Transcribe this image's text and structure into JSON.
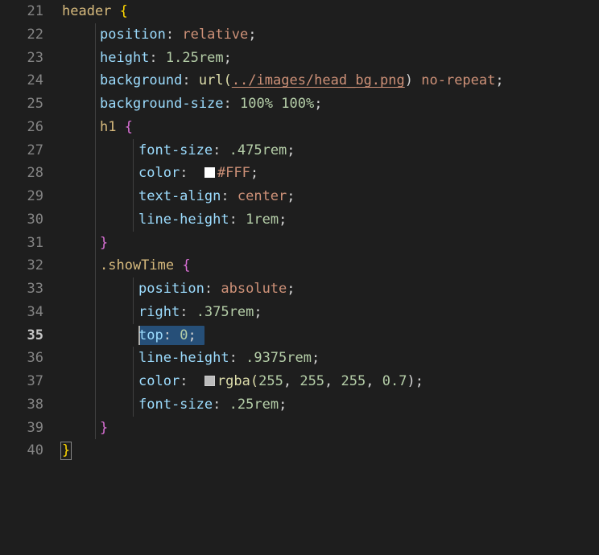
{
  "editor": {
    "language": "css",
    "theme": "Dark+ (default dark)",
    "background_color": "#1e1e1e",
    "selection_color": "#264f78",
    "cursor_color": "#aeafad",
    "first_visible_line": 21,
    "last_visible_line": 40,
    "active_line": 35,
    "selected_text": "top: 0;"
  },
  "gutter": {
    "numbers": [
      "21",
      "22",
      "23",
      "24",
      "25",
      "26",
      "27",
      "28",
      "29",
      "30",
      "31",
      "32",
      "33",
      "34",
      "35",
      "36",
      "37",
      "38",
      "39",
      "40"
    ]
  },
  "swatches": {
    "white": "#FFFFFF",
    "white_70": "rgba(255,255,255,0.7)"
  },
  "code": {
    "l21": {
      "selector": "header",
      "brace": "{"
    },
    "l22": {
      "prop": "position",
      "colon": ":",
      "value": "relative",
      "semi": ";"
    },
    "l23": {
      "prop": "height",
      "colon": ":",
      "num": "1.25",
      "unit": "rem",
      "semi": ";"
    },
    "l24": {
      "prop": "background",
      "colon": ":",
      "fn": "url(",
      "str": "../images/head_bg.png",
      "close": ")",
      "value": "no-repeat",
      "semi": ";"
    },
    "l25": {
      "prop": "background-size",
      "colon": ":",
      "v1": "100%",
      "v2": "100%",
      "semi": ";"
    },
    "l26": {
      "selector": "h1",
      "brace": "{"
    },
    "l27": {
      "prop": "font-size",
      "colon": ":",
      "num": ".475",
      "unit": "rem",
      "semi": ";"
    },
    "l28": {
      "prop": "color",
      "colon": ":",
      "hex": "#FFF",
      "semi": ";"
    },
    "l29": {
      "prop": "text-align",
      "colon": ":",
      "value": "center",
      "semi": ";"
    },
    "l30": {
      "prop": "line-height",
      "colon": ":",
      "num": "1",
      "unit": "rem",
      "semi": ";"
    },
    "l31": {
      "brace": "}"
    },
    "l32": {
      "selector": ".showTime",
      "brace": "{"
    },
    "l33": {
      "prop": "position",
      "colon": ":",
      "value": "absolute",
      "semi": ";"
    },
    "l34": {
      "prop": "right",
      "colon": ":",
      "num": ".375",
      "unit": "rem",
      "semi": ";"
    },
    "l35": {
      "prop": "top",
      "colon": ":",
      "num": "0",
      "semi": ";"
    },
    "l36": {
      "prop": "line-height",
      "colon": ":",
      "num": ".9375",
      "unit": "rem",
      "semi": ";"
    },
    "l37": {
      "prop": "color",
      "colon": ":",
      "fn": "rgba(",
      "a": "255",
      "c1": ",",
      "b": "255",
      "c2": ",",
      "c": "255",
      "c3": ",",
      "d": "0.7",
      "close": ")",
      "semi": ";"
    },
    "l38": {
      "prop": "font-size",
      "colon": ":",
      "num": ".25",
      "unit": "rem",
      "semi": ";"
    },
    "l39": {
      "brace": "}"
    },
    "l40": {
      "brace": "}"
    }
  }
}
